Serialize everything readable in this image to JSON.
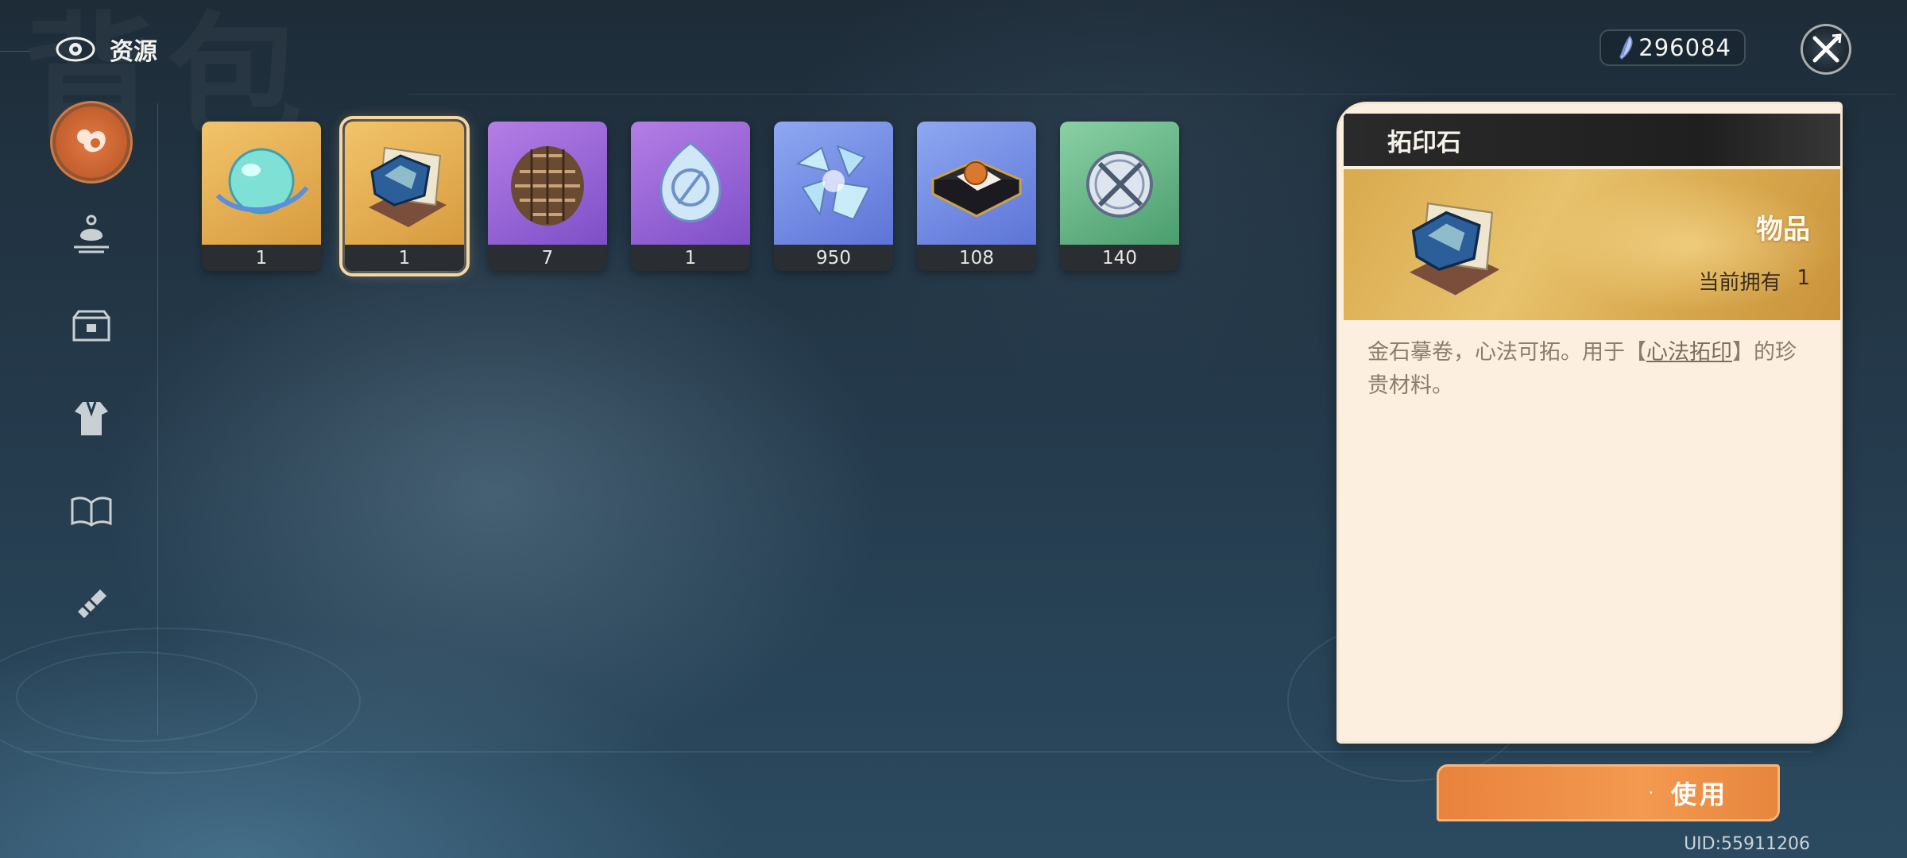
{
  "header": {
    "title": "资源",
    "icon": "eye-icon"
  },
  "currency": {
    "value": "296084",
    "icon": "feather-crystal-icon"
  },
  "sidebar": {
    "items": [
      {
        "name": "resources-tab",
        "icon": "resource-bag-icon",
        "active": true
      },
      {
        "name": "food-tab",
        "icon": "teapot-icon",
        "active": false
      },
      {
        "name": "chest-tab",
        "icon": "chest-icon",
        "active": false
      },
      {
        "name": "outfit-tab",
        "icon": "robe-icon",
        "active": false
      },
      {
        "name": "book-tab",
        "icon": "book-icon",
        "active": false
      },
      {
        "name": "scroll-tab",
        "icon": "scroll-icon",
        "active": false
      }
    ]
  },
  "items": [
    {
      "count": "1",
      "art": "jade-orb",
      "bg": "gold"
    },
    {
      "count": "1",
      "art": "rubbing-stone",
      "bg": "gold",
      "selected": true
    },
    {
      "count": "7",
      "art": "pinecone",
      "bg": "purple"
    },
    {
      "count": "1",
      "art": "crystal-drop",
      "bg": "purple"
    },
    {
      "count": "950",
      "art": "ice-shards",
      "bg": "blue"
    },
    {
      "count": "108",
      "art": "orb-box",
      "bg": "blue"
    },
    {
      "count": "140",
      "art": "sword-token",
      "bg": "green"
    }
  ],
  "detail": {
    "name": "拓印石",
    "type": "物品",
    "owned_label": "当前拥有",
    "owned_value": "1",
    "desc_pre": "金石摹卷，心法可拓。用于【",
    "desc_link": "心法拓印",
    "desc_post": "】的珍贵材料。"
  },
  "use_button": {
    "label": "使用"
  },
  "uid": "UID:55911206",
  "colors": {
    "accent": "#e9823c",
    "panel": "#fcefe0",
    "header": "#1f1f20"
  }
}
